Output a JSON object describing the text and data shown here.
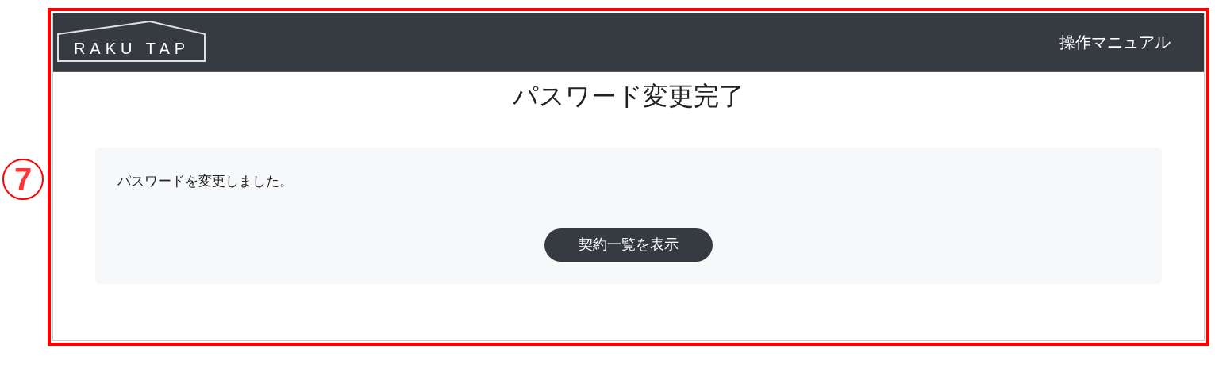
{
  "annotation": {
    "number": "7"
  },
  "header": {
    "logo": "RAKU TAP",
    "link": "操作マニュアル"
  },
  "title": "パスワード変更完了",
  "message": "パスワードを変更しました。",
  "button": "契約一覧を表示"
}
